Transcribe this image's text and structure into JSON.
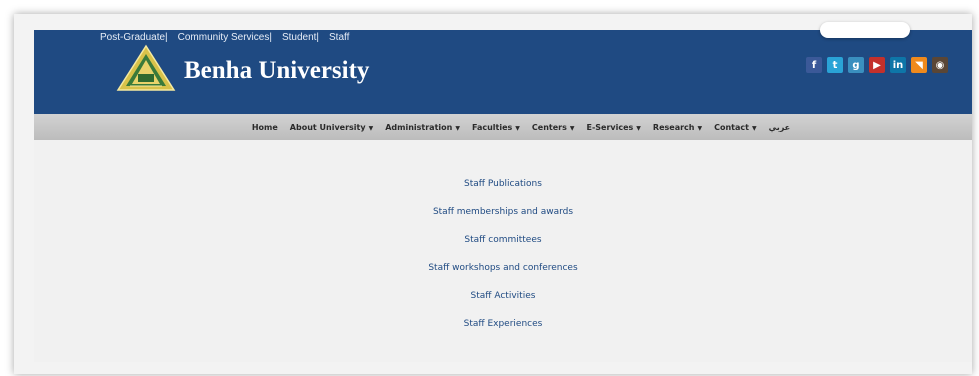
{
  "top_links": [
    "Post-Graduate|",
    "Community Services|",
    "Student|",
    "Staff"
  ],
  "brand": {
    "name": "Benha University"
  },
  "social": [
    {
      "icon": "facebook-icon",
      "glyph": "f",
      "color": "#3b5998"
    },
    {
      "icon": "twitter-icon",
      "glyph": "t",
      "color": "#2aa3d6"
    },
    {
      "icon": "google-plus-icon",
      "glyph": "g",
      "color": "#3a8fbf"
    },
    {
      "icon": "youtube-icon",
      "glyph": "▶",
      "color": "#c4302b"
    },
    {
      "icon": "linkedin-icon",
      "glyph": "in",
      "color": "#0e76a8"
    },
    {
      "icon": "rss-icon",
      "glyph": "◥",
      "color": "#f08a1c"
    },
    {
      "icon": "instagram-icon",
      "glyph": "◉",
      "color": "#5a4636"
    }
  ],
  "nav": {
    "items": [
      {
        "label": "Home",
        "dropdown": false
      },
      {
        "label": "About University",
        "dropdown": true
      },
      {
        "label": "Administration",
        "dropdown": true
      },
      {
        "label": "Faculties",
        "dropdown": true
      },
      {
        "label": "Centers",
        "dropdown": true
      },
      {
        "label": "E-Services",
        "dropdown": true
      },
      {
        "label": "Research",
        "dropdown": true
      },
      {
        "label": "Contact",
        "dropdown": true
      },
      {
        "label": "عربي",
        "dropdown": false
      }
    ],
    "caret": "▼"
  },
  "staff_links": [
    "Staff Publications",
    "Staff memberships and awards",
    "Staff committees",
    "Staff workshops and conferences",
    "Staff Activities",
    "Staff Experiences"
  ],
  "colors": {
    "header_bg": "#1f4a82",
    "navbar_bg": "#c6c6c6",
    "link": "#1f4a82"
  }
}
